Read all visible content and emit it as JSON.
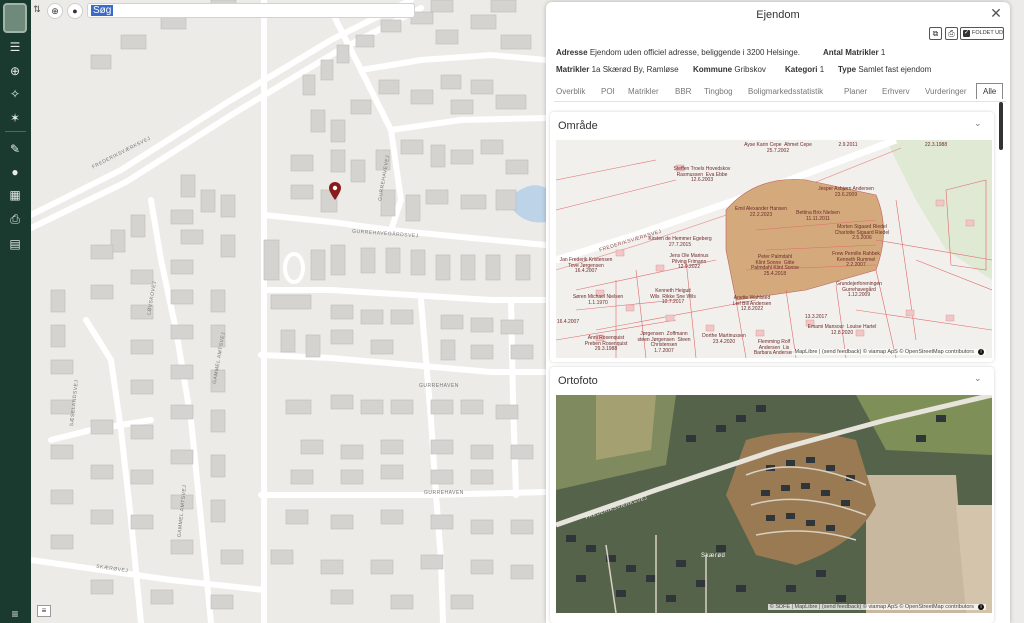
{
  "sidebar": {
    "icons": [
      "avatar",
      "swap-icon",
      "layers-icon",
      "search-zoom-icon",
      "network-icon",
      "magic-icon",
      "draw-icon",
      "group-icon",
      "grid-icon",
      "print-icon",
      "clipboard-icon",
      "menu-icon"
    ]
  },
  "search": {
    "value": "Søg"
  },
  "map": {
    "streets": [
      "FREDERIKSVÆRKSVEJ",
      "GURREHAVEVEJ",
      "GURREHAVEGÅRDSVEJ",
      "LØVSKOVEJ",
      "GAMMEL AMTSVEJ",
      "SÆSELANDSVEJ",
      "GURREHAVEN",
      "GURREHAVEN",
      "SKÆRØVEJ",
      "GAMMEL AMTSVEJ"
    ],
    "pin_color": "#8b1a1a"
  },
  "panel": {
    "title": "Ejendom",
    "unfold_label": "FOLDET UD",
    "info": {
      "adresse_label": "Adresse",
      "adresse_value": "Ejendom uden officiel adresse, beliggende i 3200 Helsinge.",
      "antal_label": "Antal Matrikler",
      "antal_value": "1",
      "matrikler_label": "Matrikler",
      "matrikler_value": "1a Skærød By, Ramløse",
      "kommune_label": "Kommune",
      "kommune_value": "Gribskov",
      "kategori_label": "Kategori",
      "kategori_value": "1",
      "type_label": "Type",
      "type_value": "Samlet fast ejendom"
    },
    "tabs": [
      "Overblik",
      "POI",
      "Matrikler",
      "BBR",
      "Tingbog",
      "Boligmarkedsstatistik",
      "Planer",
      "Erhverv",
      "Vurderinger",
      "Alle"
    ],
    "active_tab": "Alle",
    "sections": {
      "omraade": {
        "title": "Område",
        "attribution": "MapLibre | (send feedback) © viamap ApS © OpenStreetMap contributors",
        "road_label": "FREDERIKSVÆRKSVEJ",
        "owners": [
          "Ayse Karin Cepe  Ahmet Cepe\n25.7.2002",
          "2.9.2011",
          "22.3.1988",
          "Steffen Troels Hovedskov\nRasmussen  Eva Ebbe\n12.6.2003",
          "Jesper Asbjørn Andersen\n23.6.2009",
          "Emil Alexander Hansen\n22.2.2023",
          "Bettina Brix Nielsen\n11.11.2011",
          "Morten Sigaard Riedel\nCharlotte Sigaard Riedel\n2.5.2006",
          "Kirsten de Hemmer Egeberg\n27.7.2015",
          "Jens Ole Marinus\nPilving Frimann\n12.9.2022",
          "Peter Palmdahl\nKlint Sonne  Gitte\nPalmdahl Klint Sonne\n25.4.2018",
          "Frew Pernille Rahbek\nKenneth Rummel\n2.2.2007",
          "Jan Frederik Kristensen\nTove Jørgensen\n16.4.2007",
          "Kenneth Heiguit\nWils  Rikke Sne Wils\n10.7.2017",
          "Grundejerforeningen\nGurrehavegård\n1.12.2009",
          "Søren Michael Nielsen\n1.1.1970",
          "Anette Wahlsted\nLeif Bill Andersen\n12.8.2022",
          "13.3.2017",
          "Emami Mansour  Louise Hartel\n12.8.2020",
          "16.4.2007",
          "Anni Rosenquist\nPreben Rosenquist\n29.3.1988",
          "Jørgensen  Zoffmann\nsteen Jørgensen  Steen\nChristensen\n1.7.2007",
          "Dorthe Martinussen\n23.4.2020",
          "Flemming Rolf\nAndersen  Lis\nBarbara Andersen"
        ]
      },
      "ortofoto": {
        "title": "Ortofoto",
        "attribution": "© SDFE | MapLibre | (send feedback) © viamap ApS © OpenStreetMap contributors",
        "road_label": "FREDERIKSVÆRKSVEJ",
        "place_label": "Skærød"
      }
    }
  }
}
